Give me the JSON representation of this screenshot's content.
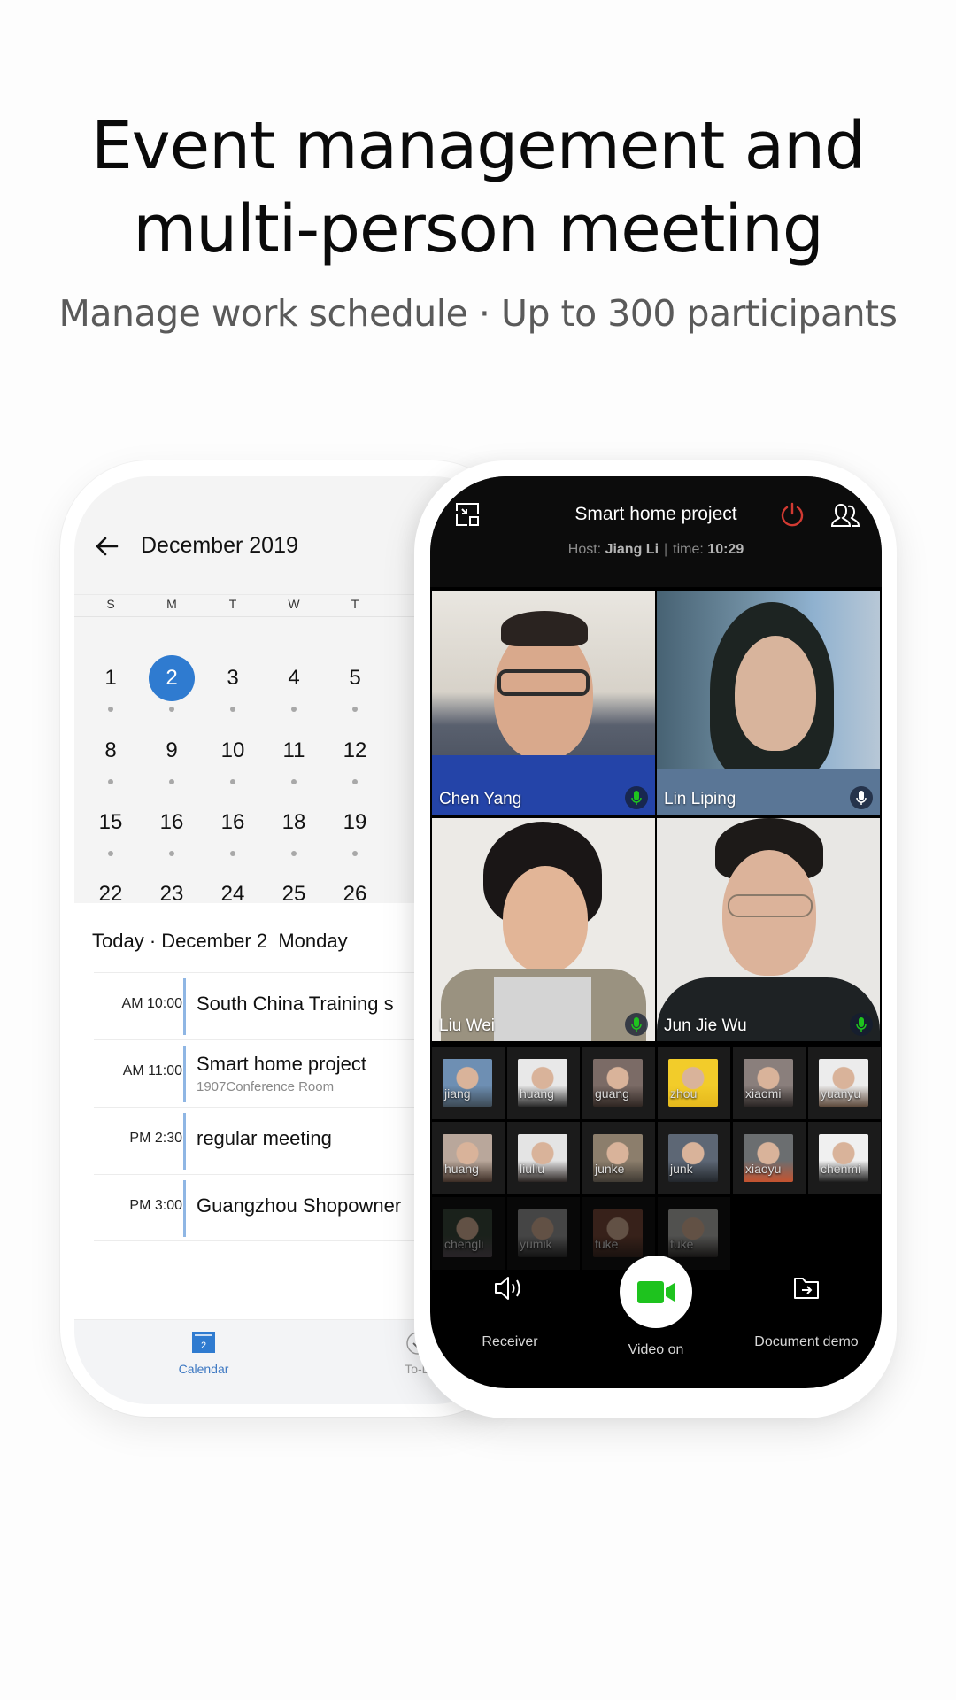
{
  "headline": {
    "line1": "Event management and",
    "line2": "multi-person meeting",
    "subtitle": "Manage work schedule · Up to 300 participants"
  },
  "calendar_app": {
    "header": {
      "back_icon": "arrow-left-icon",
      "title": "December 2019"
    },
    "weekdays": [
      "S",
      "M",
      "T",
      "W",
      "T"
    ],
    "weeks": [
      [
        "1",
        "2",
        "3",
        "4",
        "5"
      ],
      [
        "8",
        "9",
        "10",
        "11",
        "12"
      ],
      [
        "15",
        "16",
        "16",
        "18",
        "19"
      ],
      [
        "22",
        "23",
        "24",
        "25",
        "26"
      ]
    ],
    "selected_day": "2",
    "accent_color": "#2f7bd0",
    "today_label": "Today · ",
    "today_date": "December 2",
    "today_weekday": "Monday",
    "events": [
      {
        "time": "AM 10:00",
        "title": "South China Training s",
        "subtitle": ""
      },
      {
        "time": "AM 11:00",
        "title": "Smart home project",
        "subtitle": "1907Conference Room"
      },
      {
        "time": "PM 2:30",
        "title": "regular meeting",
        "subtitle": ""
      },
      {
        "time": "PM 3:00",
        "title": "Guangzhou Shopowner",
        "subtitle": ""
      }
    ],
    "tabs": [
      {
        "label": "Calendar",
        "icon": "calendar-icon",
        "icon_text": "2",
        "active": true
      },
      {
        "label": "To-D",
        "icon": "check-circle-icon",
        "active": false
      }
    ]
  },
  "meeting_app": {
    "title": "Smart home project",
    "host_label": "Host: ",
    "host_name": "Jiang Li",
    "separator": "|",
    "time_label": "time: ",
    "time_value": "10:29",
    "end_color": "#d23a32",
    "video_tiles": [
      {
        "name": "Chen Yang",
        "mic": "active"
      },
      {
        "name": "Lin Liping",
        "mic": "idle"
      },
      {
        "name": "Liu Wei",
        "mic": "active"
      },
      {
        "name": "Jun Jie Wu",
        "mic": "active"
      }
    ],
    "participants": [
      {
        "name": "jiang",
        "dim": false
      },
      {
        "name": "huang",
        "dim": false
      },
      {
        "name": "guang",
        "dim": false
      },
      {
        "name": "zhou",
        "dim": false
      },
      {
        "name": "xiaomi",
        "dim": false
      },
      {
        "name": "yuanyu",
        "dim": false
      },
      {
        "name": "huang",
        "dim": false
      },
      {
        "name": "liuliu",
        "dim": false
      },
      {
        "name": "junke",
        "dim": false
      },
      {
        "name": "junk",
        "dim": false
      },
      {
        "name": "xiaoyu",
        "dim": false
      },
      {
        "name": "chenmi",
        "dim": false
      },
      {
        "name": "chengli",
        "dim": true
      },
      {
        "name": "yumik",
        "dim": true
      },
      {
        "name": "fuke",
        "dim": true
      },
      {
        "name": "fuke",
        "dim": true
      }
    ],
    "controls": {
      "receiver_label": "Receiver",
      "video_label": "Video on",
      "document_label": "Document demo",
      "video_color": "#1ec31e"
    }
  }
}
